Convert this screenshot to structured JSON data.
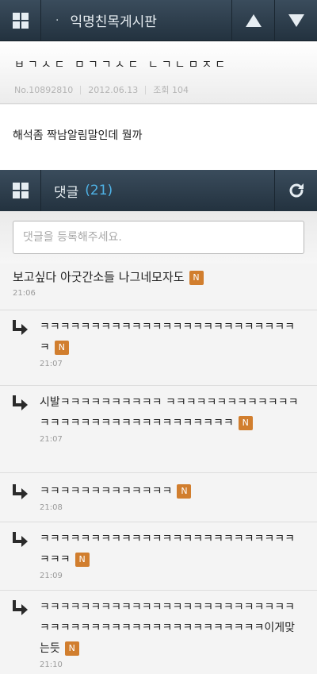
{
  "topbar": {
    "title": "익명친목게시판",
    "dot": "·"
  },
  "post": {
    "title": "ㅂㄱㅅㄷ ㅁㄱㄱㅅㄷ ㄴㄱㄴㅁㅈㄷ",
    "number": "No.10892810",
    "date": "2012.06.13",
    "views": "조회 104",
    "body": "해석좀 짝남알림말인데 뭘까"
  },
  "comments_bar": {
    "label": "댓글",
    "count": "(21)"
  },
  "comment_input": {
    "placeholder": "댓글을 등록해주세요."
  },
  "badge_label": "N",
  "comments": [
    {
      "text": "보고싶다 아굿간소들 나그네모자도",
      "time": "21:06"
    },
    {
      "text": "ㅋㅋㅋㅋㅋㅋㅋㅋㅋㅋㅋㅋㅋㅋㅋㅋㅋㅋㅋㅋㅋㅋㅋㅋㅋㅋ",
      "time": "21:07"
    },
    {
      "text": "시발ㅋㅋㅋㅋㅋㅋㅋㅋㅋㅋ ㅋㅋㅋㅋㅋㅋㅋㅋㅋㅋㅋㅋㅋㅋㅋㅋㅋㅋㅋㅋㅋㅋㅋㅋㅋㅋㅋㅋㅋㅋㅋㅋ",
      "time": "21:07"
    },
    {
      "text": "ㅋㅋㅋㅋㅋㅋㅋㅋㅋㅋㅋㅋㅋ",
      "time": "21:08"
    },
    {
      "text": "ㅋㅋㅋㅋㅋㅋㅋㅋㅋㅋㅋㅋㅋㅋㅋㅋㅋㅋㅋㅋㅋㅋㅋㅋㅋㅋㅋㅋ",
      "time": "21:09"
    },
    {
      "text": "ㅋㅋㅋㅋㅋㅋㅋㅋㅋㅋㅋㅋㅋㅋㅋㅋㅋㅋㅋㅋㅋㅋㅋㅋㅋㅋㅋㅋㅋㅋㅋㅋㅋㅋㅋㅋㅋㅋㅋㅋㅋㅋㅋㅋㅋㅋㅋ이게맞는듯",
      "time": "21:10"
    }
  ],
  "colors": {
    "bar_dark": "#23323f",
    "count_blue": "#4fb2e6",
    "badge_orange": "#d17e2e"
  }
}
